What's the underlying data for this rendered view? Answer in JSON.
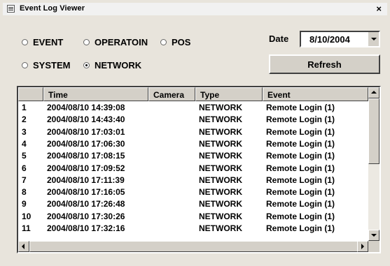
{
  "window": {
    "title": "Event Log Viewer",
    "close_glyph": "×",
    "icon": "event-log-icon"
  },
  "filters": {
    "event": {
      "label": "EVENT",
      "checked": false
    },
    "operation": {
      "label": "OPERATOIN",
      "checked": false
    },
    "pos": {
      "label": "POS",
      "checked": false
    },
    "system": {
      "label": "SYSTEM",
      "checked": false
    },
    "network": {
      "label": "NETWORK",
      "checked": true
    }
  },
  "date": {
    "label": "Date",
    "value": "8/10/2004"
  },
  "refresh_label": "Refresh",
  "table": {
    "columns": [
      "",
      "Time",
      "Camera",
      "Type",
      "Event"
    ],
    "rows": [
      [
        "1",
        "2004/08/10 14:39:08",
        "",
        "NETWORK",
        "Remote Login (1)"
      ],
      [
        "2",
        "2004/08/10 14:43:40",
        "",
        "NETWORK",
        "Remote Login (1)"
      ],
      [
        "3",
        "2004/08/10 17:03:01",
        "",
        "NETWORK",
        "Remote Login (1)"
      ],
      [
        "4",
        "2004/08/10 17:06:30",
        "",
        "NETWORK",
        "Remote Login (1)"
      ],
      [
        "5",
        "2004/08/10 17:08:15",
        "",
        "NETWORK",
        "Remote Login (1)"
      ],
      [
        "6",
        "2004/08/10 17:09:52",
        "",
        "NETWORK",
        "Remote Login (1)"
      ],
      [
        "7",
        "2004/08/10 17:11:39",
        "",
        "NETWORK",
        "Remote Login (1)"
      ],
      [
        "8",
        "2004/08/10 17:16:05",
        "",
        "NETWORK",
        "Remote Login (1)"
      ],
      [
        "9",
        "2004/08/10 17:26:48",
        "",
        "NETWORK",
        "Remote Login (1)"
      ],
      [
        "10",
        "2004/08/10 17:30:26",
        "",
        "NETWORK",
        "Remote Login (1)"
      ],
      [
        "11",
        "2004/08/10 17:32:16",
        "",
        "NETWORK",
        "Remote Login (1)"
      ]
    ]
  }
}
